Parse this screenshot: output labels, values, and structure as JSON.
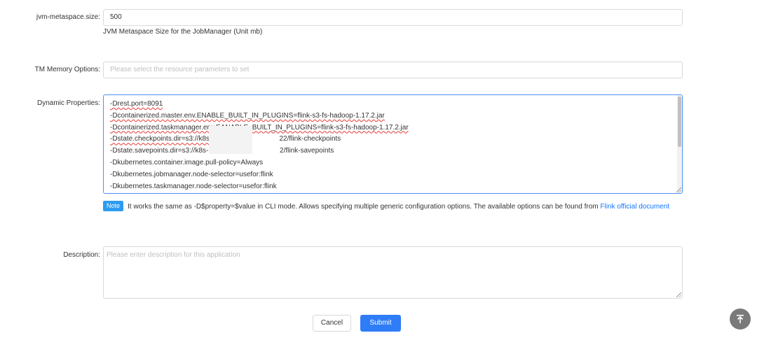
{
  "fields": {
    "metaspace": {
      "label": "jvm-metaspace.size:",
      "value": "500",
      "help": "JVM Metaspace Size for the JobManager (Unit mb)"
    },
    "tm_memory": {
      "label": "TM Memory Options:",
      "placeholder": "Please select the resource parameters to set"
    },
    "dynamic_properties": {
      "label": "Dynamic Properties:",
      "lines": [
        "-Drest.port=8091",
        "-Dcontainerized.master.env.ENABLE_BUILT_IN_PLUGINS=flink-s3-fs-hadoop-1.17.2.jar",
        "-Dcontainerized.taskmanager.env.EANABLE_BUILT_IN_PLUGINS=flink-s3-fs-hadoop-1.17.2.jar",
        "-Dstate.checkpoints.dir=s3://k8s-bigdata-",
        "22/flink-checkpoints",
        "-Dstate.savepoints.dir=s3://k8s-bigdata-1",
        "2/flink-savepoints",
        "-Dkubernetes.container.image.pull-policy=Always",
        "-Dkubernetes.jobmanager.node-selector=usefor:flink",
        "-Dkubernetes.taskmanager.node-selector=usefor:flink"
      ]
    },
    "note": {
      "badge": "Note",
      "text": "It works the same as -D$property=$value in CLI mode. Allows specifying multiple generic configuration options. The available options can be found from",
      "link": "Flink official document"
    },
    "description": {
      "label": "Description:",
      "placeholder": "Please enter description for this application"
    }
  },
  "actions": {
    "cancel": "Cancel",
    "submit": "Submit"
  },
  "icons": {
    "back_to_top": "vertical-align-top-icon"
  },
  "colors": {
    "primary": "#2f7df6",
    "link": "#1677ff",
    "note_badge": "#2d9cf0",
    "spellcheck": "#e53935"
  }
}
